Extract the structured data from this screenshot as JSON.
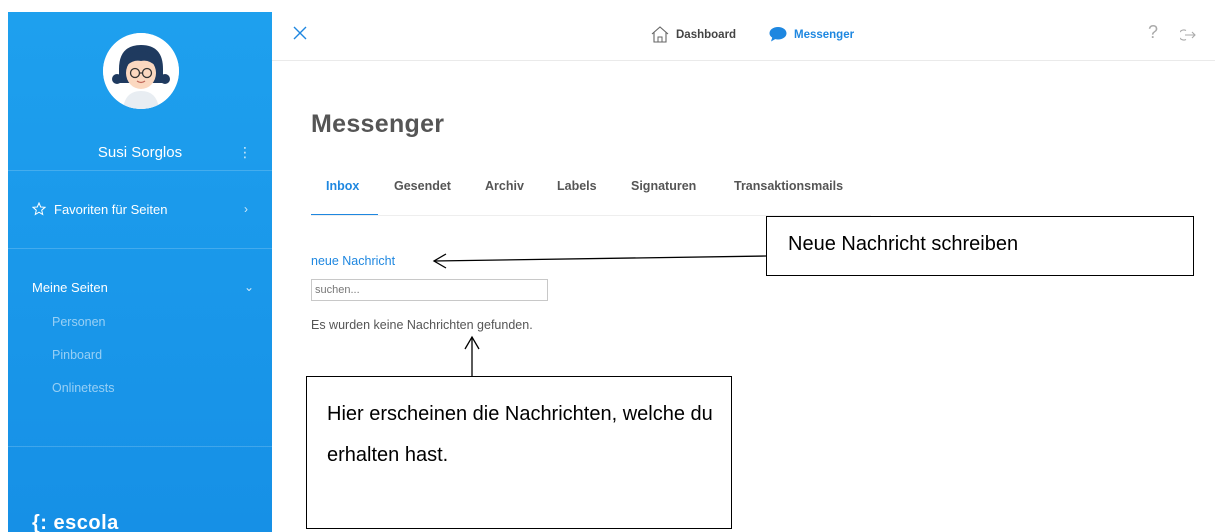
{
  "sidebar": {
    "user_name": "Susi Sorglos",
    "user_menu_glyph": "⋮",
    "favorites_label": "Favoriten für Seiten",
    "favorites_chevron": "›",
    "my_pages_label": "Meine Seiten",
    "my_pages_chevron": "⌄",
    "sub_items": [
      "Personen",
      "Pinboard",
      "Onlinetests"
    ],
    "brand": "{: escola",
    "colors": {
      "background": "#1a98ec"
    }
  },
  "topbar": {
    "dashboard_label": "Dashboard",
    "messenger_label": "Messenger",
    "help_glyph": "?",
    "icons": [
      "close-icon",
      "home-icon",
      "chat-bubble-icon",
      "help-icon",
      "logout-icon"
    ]
  },
  "main": {
    "title": "Messenger",
    "tabs": [
      {
        "label": "Inbox",
        "active": true
      },
      {
        "label": "Gesendet",
        "active": false
      },
      {
        "label": "Archiv",
        "active": false
      },
      {
        "label": "Labels",
        "active": false
      },
      {
        "label": "Signaturen",
        "active": false
      },
      {
        "label": "Transaktionsmails",
        "active": false
      }
    ],
    "new_message_link": "neue Nachricht",
    "search_placeholder": "suchen...",
    "empty_message": "Es wurden keine Nachrichten gefunden.",
    "colors": {
      "accent": "#1e87e0"
    }
  },
  "annotations": {
    "top_callout": "Neue Nachricht schreiben",
    "bottom_callout": "Hier erscheinen die Nachrichten, welche du erhalten hast."
  }
}
